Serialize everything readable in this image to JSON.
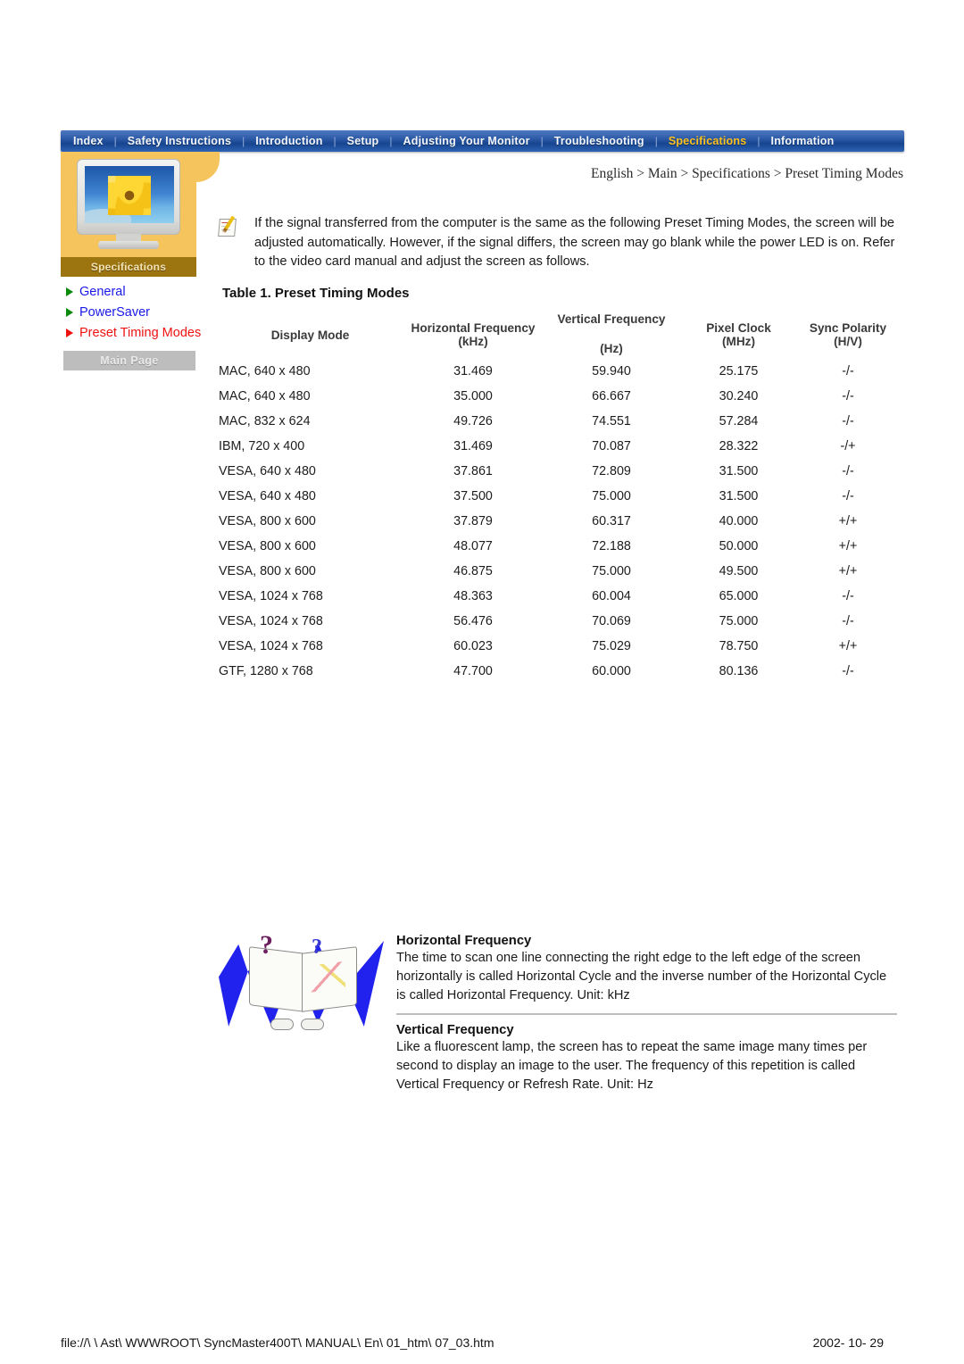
{
  "nav": {
    "items": [
      {
        "label": "Index",
        "active": false
      },
      {
        "label": "Safety Instructions",
        "active": false
      },
      {
        "label": "Introduction",
        "active": false
      },
      {
        "label": "Setup",
        "active": false
      },
      {
        "label": "Adjusting Your Monitor",
        "active": false
      },
      {
        "label": "Troubleshooting",
        "active": false
      },
      {
        "label": "Specifications",
        "active": true
      },
      {
        "label": "Information",
        "active": false
      }
    ],
    "separator": "|",
    "active_color": "#ffc21e"
  },
  "sidebar": {
    "caption": "Specifications",
    "items": [
      {
        "label": "General",
        "selected": false
      },
      {
        "label": "PowerSaver",
        "selected": false
      },
      {
        "label": "Preset Timing Modes",
        "selected": true
      }
    ],
    "main_page_button": "Main Page",
    "link_color": "#1818e8",
    "selected_color": "#ee1111"
  },
  "breadcrumb": "English > Main > Specifications > Preset Timing Modes",
  "note": "If the signal transferred from the computer is the same as the following Preset Timing Modes, the screen will be adjusted automatically. However, if the signal differs, the screen may go blank while the power LED is on. Refer to the video card manual and adjust the screen as follows.",
  "table": {
    "title": "Table 1. Preset Timing Modes",
    "headers": [
      {
        "main": "Display Mode",
        "sub": ""
      },
      {
        "main": "Horizontal Frequency",
        "sub": "(kHz)"
      },
      {
        "main": "Vertical Frequency",
        "sub": "(Hz)"
      },
      {
        "main": "Pixel Clock",
        "sub": "(MHz)"
      },
      {
        "main": "Sync Polarity",
        "sub": "(H/V)"
      }
    ],
    "rows": [
      [
        "MAC, 640 x 480",
        "31.469",
        "59.940",
        "25.175",
        "-/-"
      ],
      [
        "MAC, 640 x 480",
        "35.000",
        "66.667",
        "30.240",
        "-/-"
      ],
      [
        "MAC, 832 x 624",
        "49.726",
        "74.551",
        "57.284",
        "-/-"
      ],
      [
        "IBM, 720 x 400",
        "31.469",
        "70.087",
        "28.322",
        "-/+"
      ],
      [
        "VESA, 640 x 480",
        "37.861",
        "72.809",
        "31.500",
        "-/-"
      ],
      [
        "VESA, 640 x 480",
        "37.500",
        "75.000",
        "31.500",
        "-/-"
      ],
      [
        "VESA, 800 x 600",
        "37.879",
        "60.317",
        "40.000",
        "+/+"
      ],
      [
        "VESA, 800 x 600",
        "48.077",
        "72.188",
        "50.000",
        "+/+"
      ],
      [
        "VESA, 800 x 600",
        "46.875",
        "75.000",
        "49.500",
        "+/+"
      ],
      [
        "VESA, 1024 x 768",
        "48.363",
        "60.004",
        "65.000",
        "-/-"
      ],
      [
        "VESA, 1024 x 768",
        "56.476",
        "70.069",
        "75.000",
        "-/-"
      ],
      [
        "VESA, 1024 x 768",
        "60.023",
        "75.029",
        "78.750",
        "+/+"
      ],
      [
        "GTF, 1280 x 768",
        "47.700",
        "60.000",
        "80.136",
        "-/-"
      ]
    ]
  },
  "info": {
    "horizontal": {
      "heading": "Horizontal Frequency",
      "body": "The time to scan one line connecting the right edge to the left edge of the screen horizontally is called Horizontal Cycle and the inverse number of the Horizontal Cycle is called Horizontal Frequency. Unit: kHz"
    },
    "vertical": {
      "heading": "Vertical Frequency",
      "body": "Like a fluorescent lamp, the screen has to repeat the same image many times per second to display an image to the user. The frequency of this repetition is called Vertical Frequency or Refresh Rate. Unit: Hz"
    }
  },
  "footer": {
    "path": "file://\\ \\ Ast\\ WWWROOT\\ SyncMaster400T\\ MANUAL\\ En\\ 01_htm\\ 07_03.htm",
    "date": "2002- 10- 29"
  }
}
